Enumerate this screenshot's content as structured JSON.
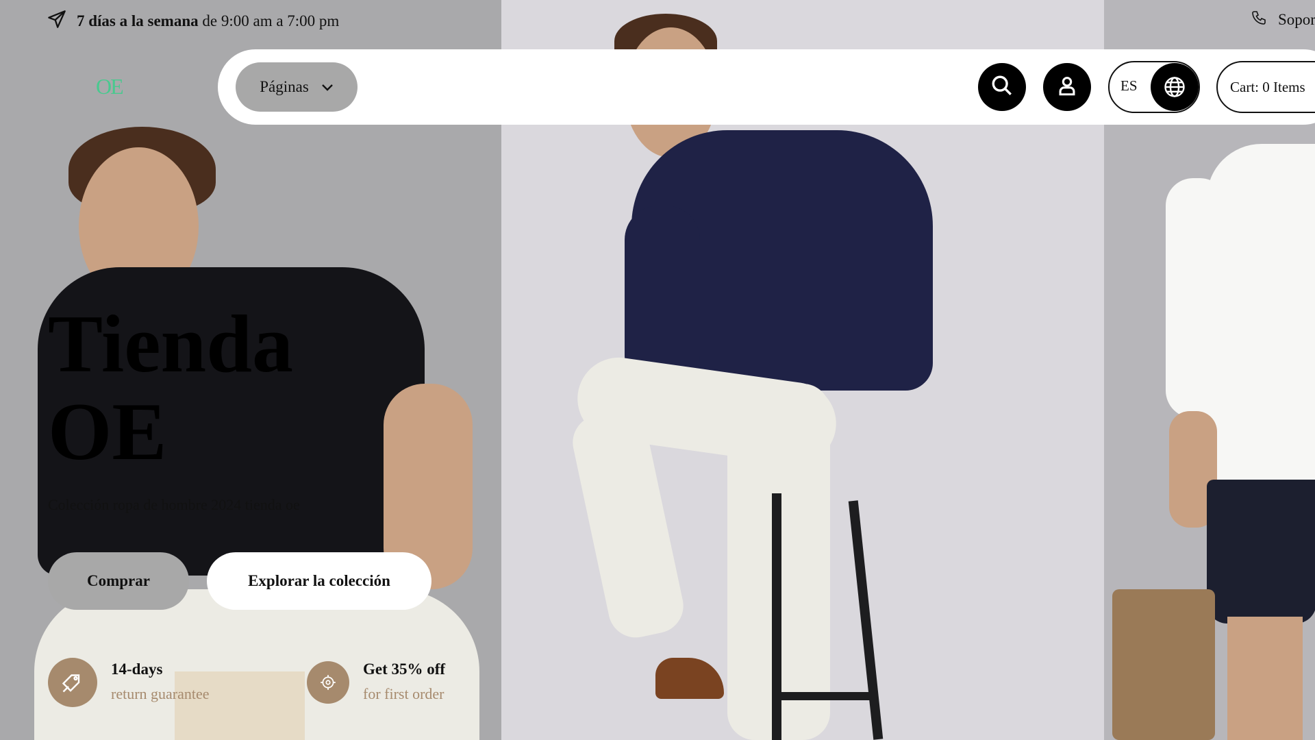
{
  "topbar": {
    "schedule_bold": "7 días a la semana",
    "schedule_rest": "de 9:00 am a 7:00 pm",
    "support": "Soporte"
  },
  "logo": "OE",
  "nav": {
    "pages_label": "Páginas",
    "lang": "ES",
    "cart": "Cart: 0 Items"
  },
  "hero": {
    "title_line1": "Tienda",
    "title_line2": "OE",
    "subtitle": "Colección ropa de hombre 2024 tienda oe",
    "shop_button": "Comprar",
    "explore_button": "Explorar la colección"
  },
  "features": [
    {
      "icon": "return-tag-icon",
      "title": "14-days",
      "sub": "return guarantee"
    },
    {
      "icon": "discount-badge-icon",
      "title": "Get 35% off",
      "sub": "for first order"
    }
  ],
  "colors": {
    "accent_brown": "#a68a6d",
    "logo_green": "#49c98f",
    "button_gray": "#a8a8a8"
  }
}
